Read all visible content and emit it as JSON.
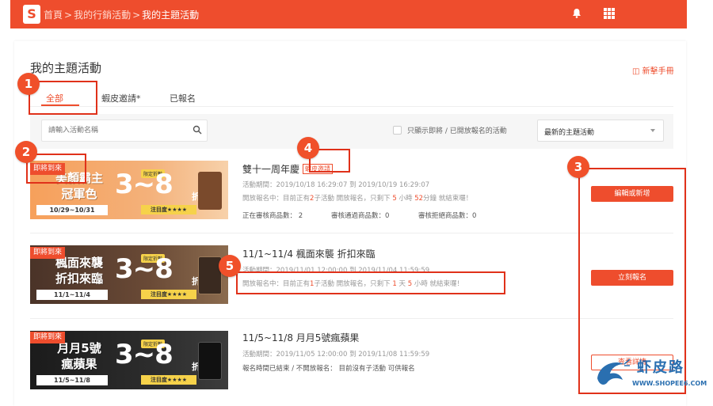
{
  "header": {
    "logo": "S",
    "breadcrumb": [
      "首頁",
      "我的行銷活動",
      "我的主題活動"
    ],
    "separator": ">"
  },
  "page_title": "我的主題活動",
  "help_link": "◫ 新擊手冊",
  "tabs": [
    {
      "label": "全部",
      "active": true
    },
    {
      "label": "蝦皮邀請*",
      "active": false
    },
    {
      "label": "已報名",
      "active": false
    }
  ],
  "search": {
    "placeholder": "請輸入活動名稱"
  },
  "filter_checkbox_label": "只顯示即將 / 已開放報名的活動",
  "sort_select": {
    "value": "最新的主題活動"
  },
  "events": [
    {
      "badge": "即將到來",
      "banner_title_line1": "美顏霸主",
      "banner_title_line2": "冠軍色",
      "banner_date": "10/29~10/31",
      "banner_big": "3~8",
      "banner_zhe": "折",
      "banner_tag": "限定折數",
      "banner_rate": "注目度★★★★",
      "title": "雙十一周年慶",
      "tag": "蝦皮邀請",
      "period": "活動期間：2019/10/18 16:29:07 到 2019/10/19 16:29:07",
      "status_a": "開放報名中：目前正有",
      "status_count": "2",
      "status_b": "子活動 開放報名，只剩下",
      "status_days": "5",
      "status_c": "小時",
      "status_mins": "52",
      "status_d": "分鐘 就結束囉！",
      "stat1": "正在審核商品數： 2",
      "stat2": "審核通過商品數：0",
      "stat3": "審核拒絕商品數：0",
      "button": "編輯或新增"
    },
    {
      "badge": "即將到來",
      "banner_title_line1": "楓面來襲",
      "banner_title_line2": "折扣來臨",
      "banner_date": "11/1~11/4",
      "banner_big": "3~8",
      "banner_zhe": "折",
      "banner_tag": "限定折數",
      "banner_rate": "注目度★★★★",
      "title": "11/1~11/4 楓面來襲 折扣來臨",
      "period": "活動期間：2019/11/01 12:00:00 到 2019/11/04 11:59:59",
      "status_a": "開放報名中：目前正有",
      "status_count": "1",
      "status_b": "子活動 開放報名，只剩下",
      "status_days": "1",
      "status_c": "天",
      "status_hours": "5",
      "status_d": "小時 就結束囉！",
      "button": "立刻報名"
    },
    {
      "badge": "即將到來",
      "banner_title_line1": "月月5號",
      "banner_title_line2": "瘋蘋果",
      "banner_date": "11/5~11/8",
      "banner_big": "3~8",
      "banner_zhe": "折",
      "banner_tag": "限定折數",
      "banner_rate": "注目度★★★★",
      "title": "11/5~11/8 月月5號瘋蘋果",
      "period": "活動期間：2019/11/05 12:00:00 到 2019/11/08 11:59:59",
      "status": "報名時間已結束 / 不開放報名： 目前沒有子活動 可供報名",
      "button": "查看詳情"
    }
  ],
  "annotations": [
    "1",
    "2",
    "3",
    "4",
    "5"
  ],
  "watermark": {
    "cn": "虾皮路",
    "url": "WWW.SHOPEE6.COM"
  },
  "colors": {
    "brand": "#ee4d2d",
    "annotation": "#e0311a"
  }
}
